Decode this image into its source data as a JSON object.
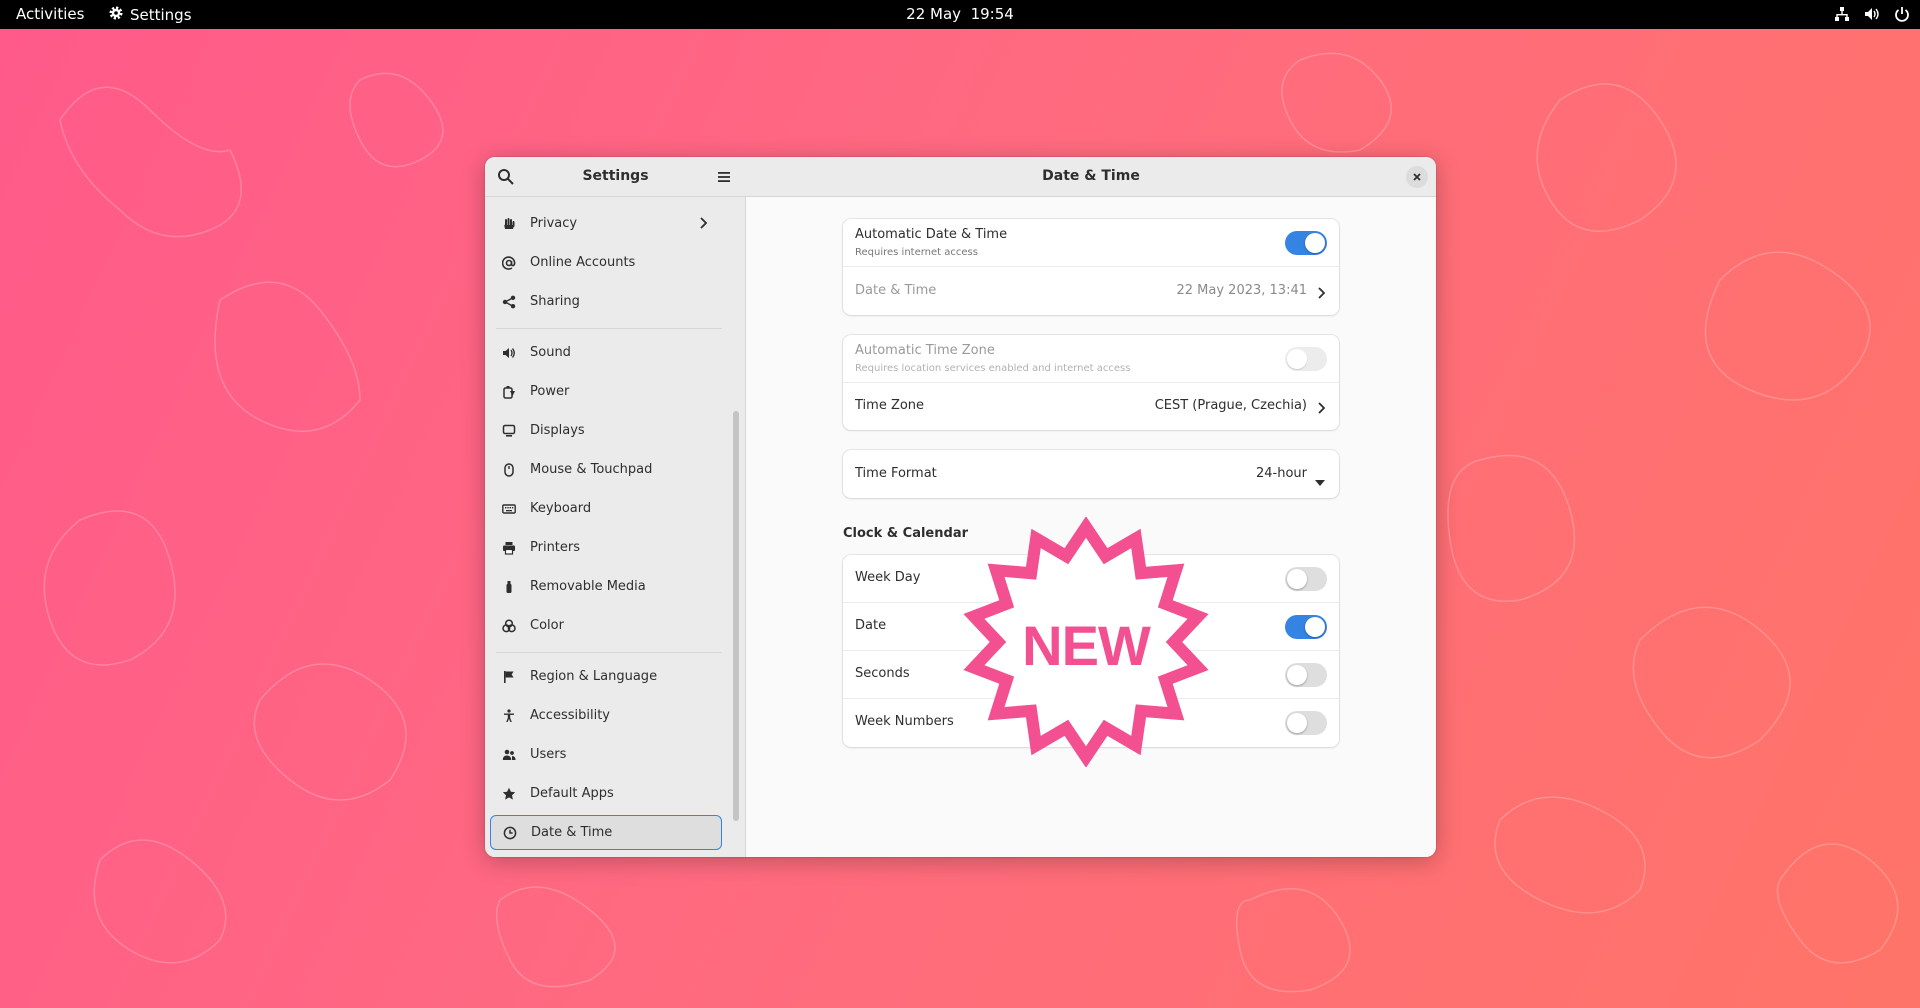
{
  "topbar": {
    "activities": "Activities",
    "app_name": "Settings",
    "clock": "22 May  19:54",
    "tray_icons": [
      "network-icon",
      "volume-icon",
      "power-icon"
    ]
  },
  "sidebar": {
    "title": "Settings",
    "items": [
      {
        "label": "Privacy",
        "icon": "hand-icon"
      },
      {
        "label": "Online Accounts",
        "icon": "at-icon"
      },
      {
        "label": "Sharing",
        "icon": "share-icon"
      },
      {
        "label": "Sound",
        "icon": "speaker-icon"
      },
      {
        "label": "Power",
        "icon": "battery-icon"
      },
      {
        "label": "Displays",
        "icon": "display-icon"
      },
      {
        "label": "Mouse & Touchpad",
        "icon": "mouse-icon"
      },
      {
        "label": "Keyboard",
        "icon": "keyboard-icon"
      },
      {
        "label": "Printers",
        "icon": "printer-icon"
      },
      {
        "label": "Removable Media",
        "icon": "usb-icon"
      },
      {
        "label": "Color",
        "icon": "color-icon"
      },
      {
        "label": "Region & Language",
        "icon": "flag-icon"
      },
      {
        "label": "Accessibility",
        "icon": "accessibility-icon"
      },
      {
        "label": "Users",
        "icon": "users-icon"
      },
      {
        "label": "Default Apps",
        "icon": "star-icon"
      },
      {
        "label": "Date & Time",
        "icon": "clock-icon",
        "selected": true
      }
    ]
  },
  "content": {
    "title": "Date & Time",
    "auto_datetime": {
      "title": "Automatic Date & Time",
      "subtitle": "Requires internet access",
      "enabled": true
    },
    "datetime": {
      "title": "Date & Time",
      "value": "22 May 2023, 13:41"
    },
    "auto_timezone": {
      "title": "Automatic Time Zone",
      "subtitle": "Requires location services enabled and internet access",
      "enabled": false
    },
    "timezone": {
      "title": "Time Zone",
      "value": "CEST (Prague, Czechia)"
    },
    "time_format": {
      "title": "Time Format",
      "value": "24-hour"
    },
    "clock_calendar": {
      "heading": "Clock & Calendar",
      "rows": [
        {
          "title": "Week Day",
          "enabled": false
        },
        {
          "title": "Date",
          "enabled": true
        },
        {
          "title": "Seconds",
          "enabled": false
        },
        {
          "title": "Week Numbers",
          "enabled": false
        }
      ]
    },
    "badge": "NEW"
  },
  "colors": {
    "accent": "#3584e4",
    "badge": "#f25090",
    "wallpaper_start": "#ff5a8a",
    "wallpaper_end": "#ff7468"
  }
}
